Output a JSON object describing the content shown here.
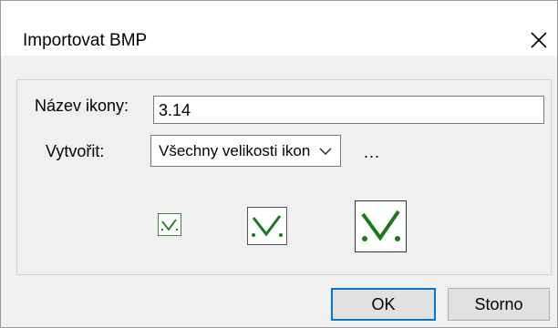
{
  "window": {
    "title": "Importovat BMP"
  },
  "form": {
    "name_label": "Název ikony:",
    "name_value": "3.14",
    "create_label": "Vytvořit:",
    "create_value": "Všechny velikosti ikon",
    "more_label": "..."
  },
  "previews": [
    "small-checkmark-icon",
    "medium-checkmark-icon",
    "large-checkmark-icon"
  ],
  "buttons": {
    "ok_label": "OK",
    "cancel_label": "Storno"
  },
  "colors": {
    "accent": "#0078d7",
    "icon_green": "#1a7a1a"
  }
}
